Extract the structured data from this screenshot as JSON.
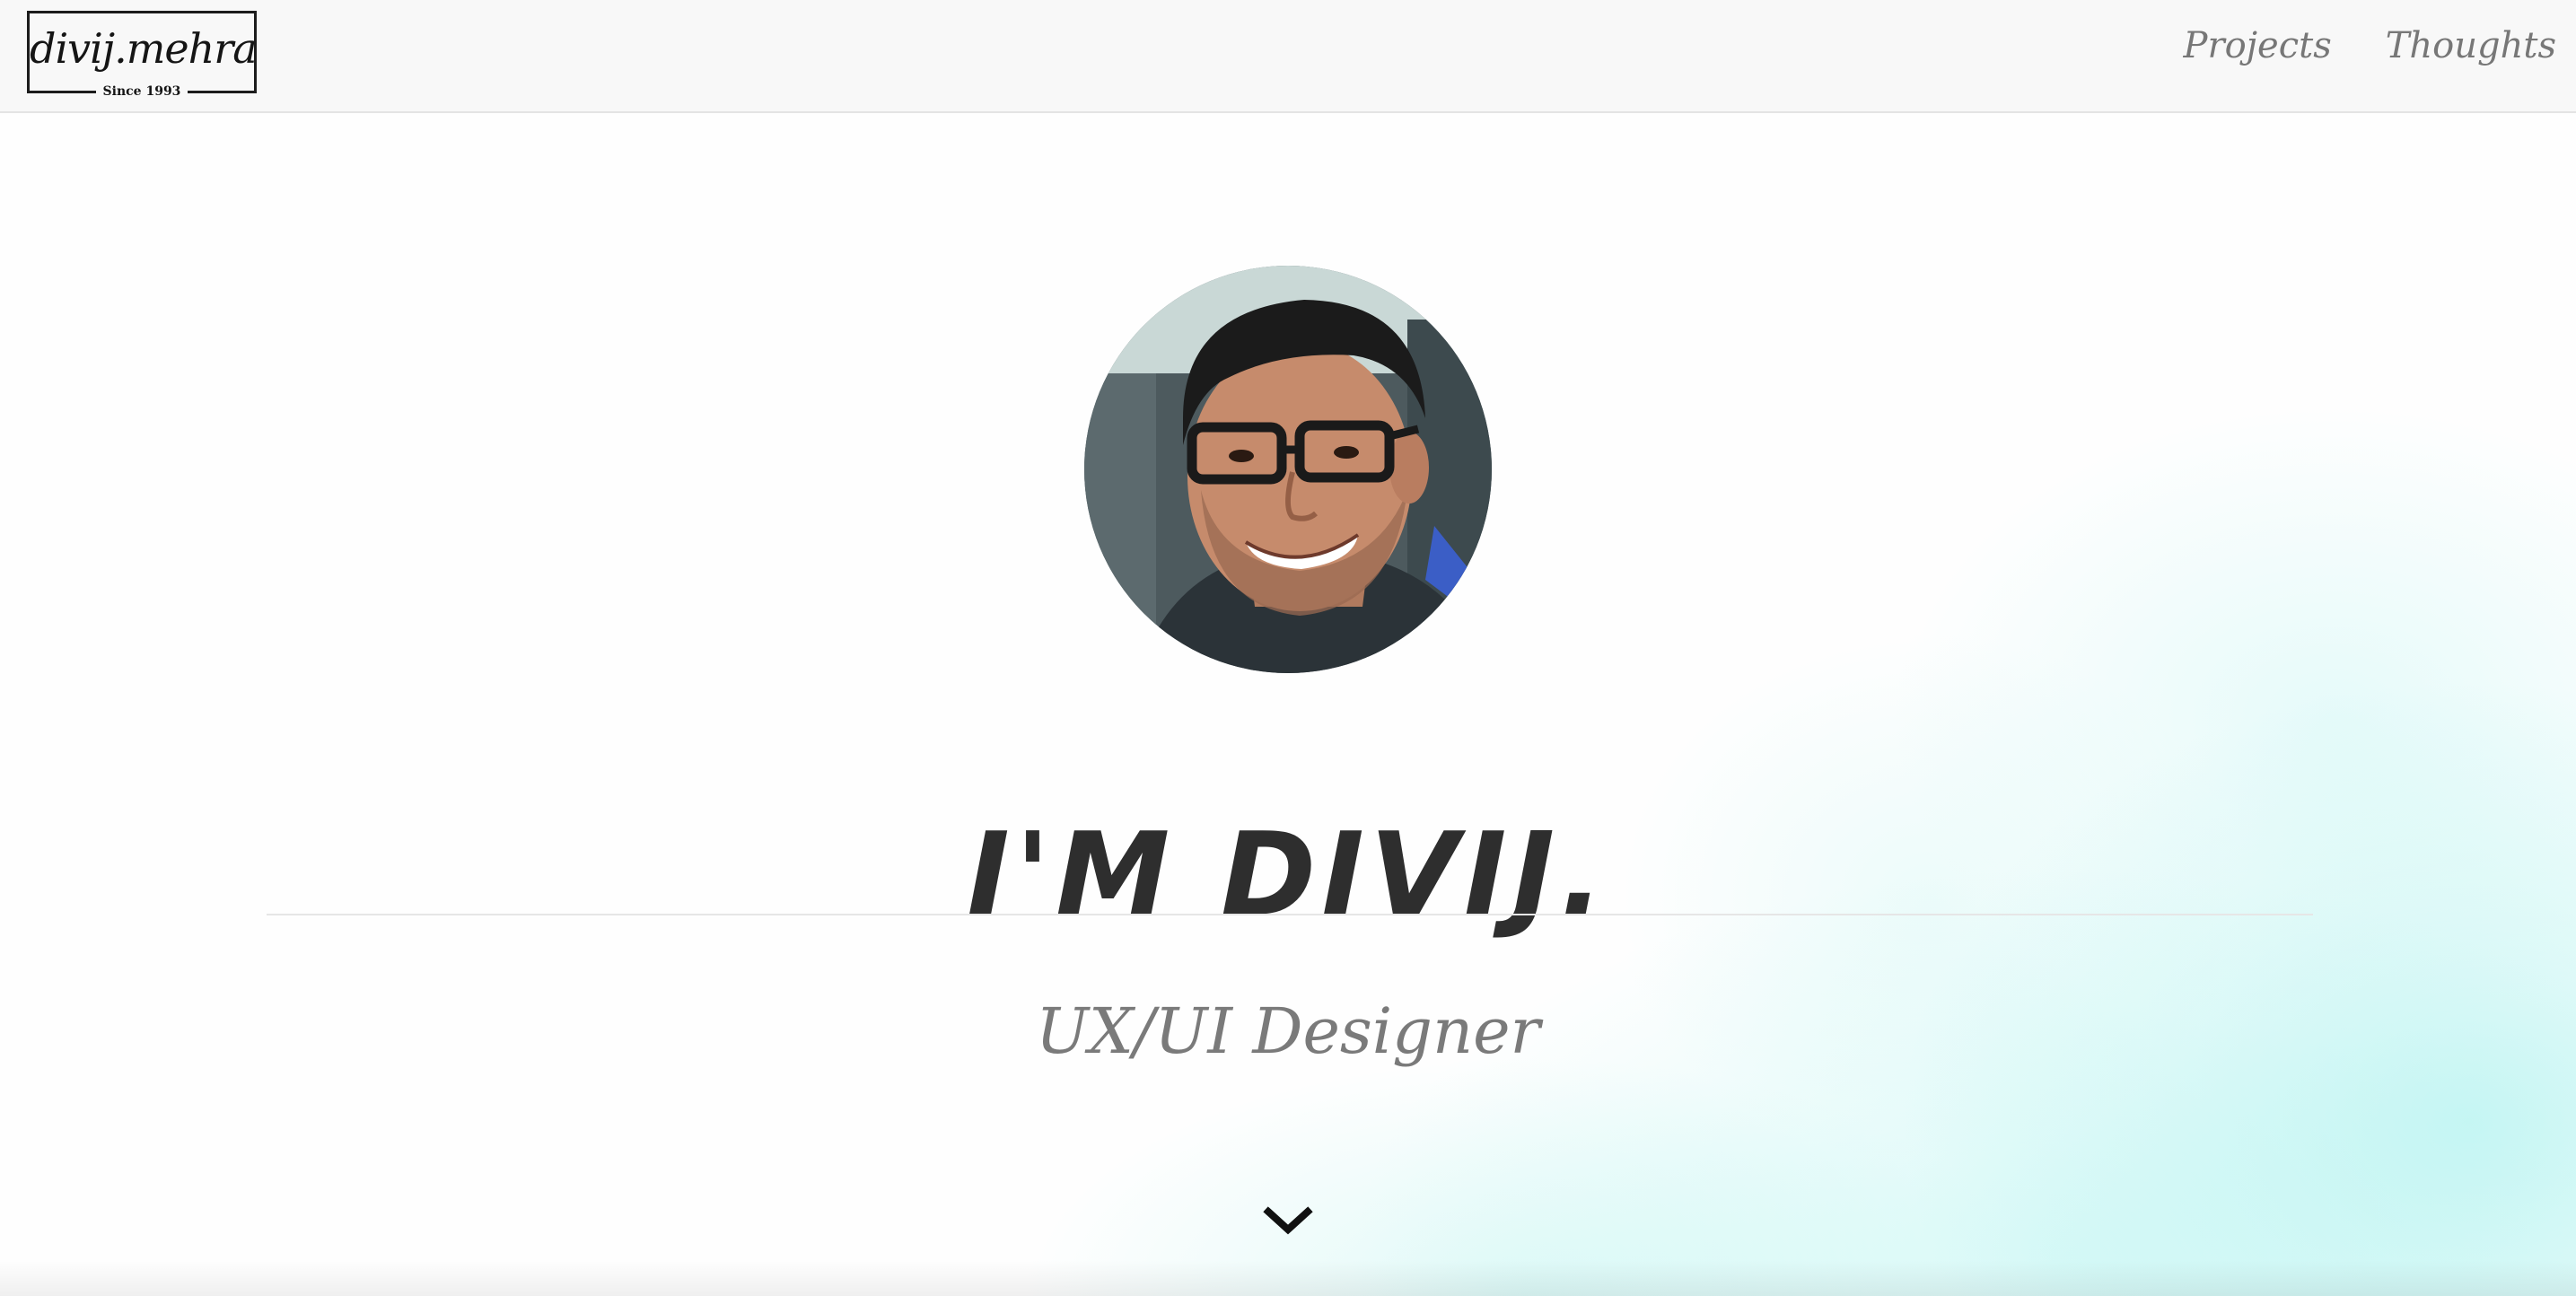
{
  "header": {
    "logo": {
      "name": "divij.mehra",
      "since": "Since 1993"
    },
    "nav": [
      {
        "label": "Projects"
      },
      {
        "label": "Thoughts"
      }
    ]
  },
  "hero": {
    "avatar_icon": "profile-photo",
    "title": "I'M DIVIJ.",
    "subtitle": "UX/UI Designer",
    "scroll_icon": "chevron-down-icon"
  },
  "colors": {
    "header_bg": "#f8f8f8",
    "title": "#2e2e2e",
    "subtitle": "#7a7a7a",
    "nav_text": "#777777",
    "accent_wash": "#a0f0ec"
  }
}
